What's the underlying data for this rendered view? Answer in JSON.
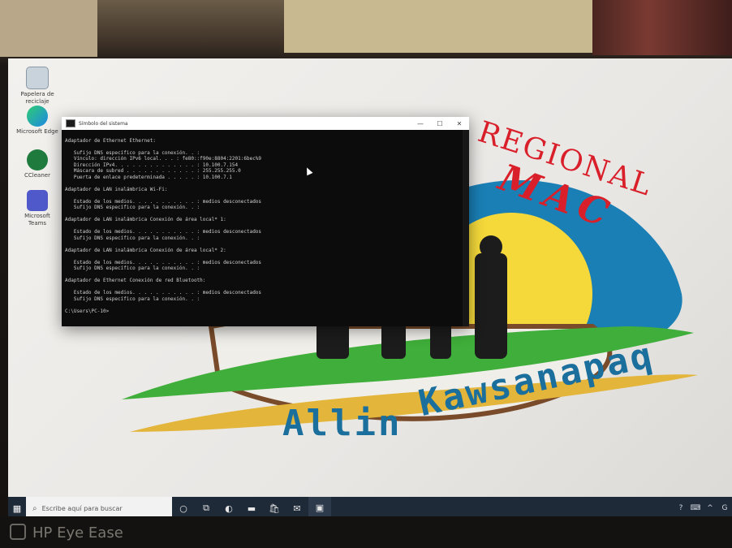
{
  "monitor": {
    "brand_label": "HP Eye Ease"
  },
  "wallpaper": {
    "top_arc_text": "REGIONAL",
    "mac_text": "MAC",
    "bottom_left_text": "Allin",
    "bottom_right_text": "Kawsanapaq",
    "colors": {
      "red": "#d91f2a",
      "blue": "#1a6f9c",
      "green": "#3fae3a",
      "yellow": "#f3d63b",
      "brown": "#7a4b2a"
    }
  },
  "desktop_icons": [
    {
      "label": "Papelera de reciclaje",
      "icon": "recycle-bin-icon"
    },
    {
      "label": "Microsoft Edge",
      "icon": "edge-icon"
    },
    {
      "label": "CCleaner",
      "icon": "app-icon"
    },
    {
      "label": "Microsoft Teams",
      "icon": "teams-icon"
    }
  ],
  "cmd_window": {
    "title": "Símbolo del sistema",
    "controls": {
      "minimize": "—",
      "maximize": "☐",
      "close": "✕"
    },
    "lines": [
      "",
      "Adaptador de Ethernet Ethernet:",
      "",
      "   Sufijo DNS específico para la conexión. . :",
      "   Vínculo: dirección IPv6 local. . . : fe80::f90e:8804:2201:6bec%9",
      "   Dirección IPv4. . . . . . . . . . . . . . : 10.100.7.154",
      "   Máscara de subred . . . . . . . . . . . . : 255.255.255.0",
      "   Puerta de enlace predeterminada . . . . . : 10.100.7.1",
      "",
      "Adaptador de LAN inalámbrica Wi-Fi:",
      "",
      "   Estado de los medios. . . . . . . . . . . : medios desconectados",
      "   Sufijo DNS específico para la conexión. . :",
      "",
      "Adaptador de LAN inalámbrica Conexión de área local* 1:",
      "",
      "   Estado de los medios. . . . . . . . . . . : medios desconectados",
      "   Sufijo DNS específico para la conexión. . :",
      "",
      "Adaptador de LAN inalámbrica Conexión de área local* 2:",
      "",
      "   Estado de los medios. . . . . . . . . . . : medios desconectados",
      "   Sufijo DNS específico para la conexión. . :",
      "",
      "Adaptador de Ethernet Conexión de red Bluetooth:",
      "",
      "   Estado de los medios. . . . . . . . . . . : medios desconectados",
      "   Sufijo DNS específico para la conexión. . :",
      "",
      "C:\\Users\\PC-10>"
    ]
  },
  "taskbar": {
    "start_icon": "windows-start-icon",
    "search_placeholder": "Escribe aquí para buscar",
    "icons": [
      {
        "name": "cortana-icon",
        "glyph": "○"
      },
      {
        "name": "task-view-icon",
        "glyph": "⧉"
      },
      {
        "name": "edge-icon",
        "glyph": "◐"
      },
      {
        "name": "file-explorer-icon",
        "glyph": "▬"
      },
      {
        "name": "store-icon",
        "glyph": "🛍"
      },
      {
        "name": "mail-icon",
        "glyph": "✉"
      },
      {
        "name": "cmd-icon",
        "glyph": "▣"
      }
    ],
    "tray": [
      {
        "name": "help-icon",
        "glyph": "?"
      },
      {
        "name": "keyboard-icon",
        "glyph": "⌨"
      },
      {
        "name": "chevron-up-icon",
        "glyph": "^"
      },
      {
        "name": "network-icon",
        "glyph": "G"
      }
    ]
  }
}
